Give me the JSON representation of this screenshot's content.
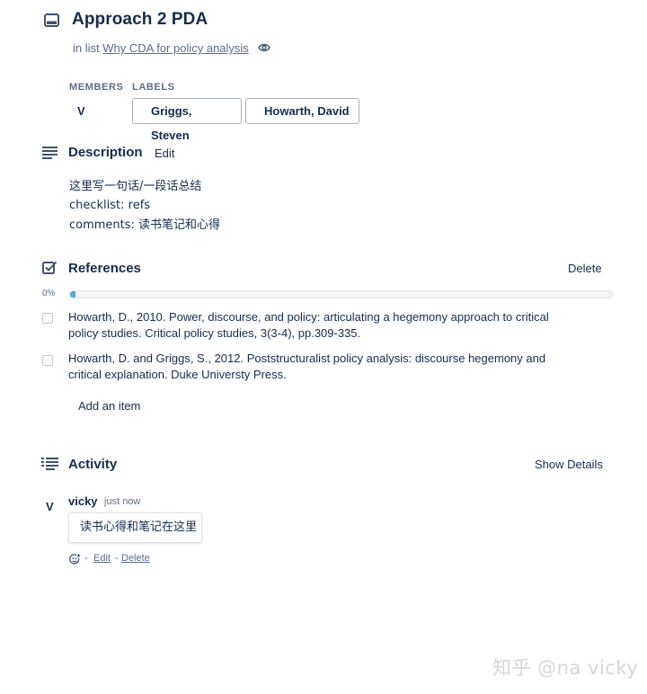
{
  "card": {
    "title": "Approach 2 PDA",
    "in_list_prefix": "in list",
    "list_name": "Why CDA for policy analysis"
  },
  "members": {
    "heading": "MEMBERS",
    "avatar_initial": "V"
  },
  "labels": {
    "heading": "LABELS",
    "items": [
      "Griggs, Steven",
      "Howarth, David"
    ]
  },
  "description": {
    "title": "Description",
    "edit_label": "Edit",
    "lines": [
      "这里写一句话/一段话总结",
      "checklist: refs",
      "comments: 读书笔记和心得"
    ]
  },
  "checklist": {
    "title": "References",
    "delete_label": "Delete",
    "progress_label": "0%",
    "progress": 0.01,
    "items": [
      {
        "text": "Howarth, D., 2010. Power, discourse, and policy: articulating a hegemony approach to critical policy studies. Critical policy studies, 3(3-4), pp.309-335.",
        "checked": false
      },
      {
        "text": "Howarth, D. and Griggs, S., 2012. Poststructuralist policy analysis: discourse hegemony and critical explanation. Duke Universty Press.",
        "checked": false
      }
    ],
    "add_item_label": "Add an item"
  },
  "activity": {
    "title": "Activity",
    "show_details_label": "Show Details",
    "comment": {
      "avatar_initial": "V",
      "author": "vicky",
      "time": "just now",
      "text": "读书心得和笔记在这里",
      "separator": "-",
      "edit_label": "Edit",
      "delete_label": "Delete"
    }
  },
  "watermark": "知乎 @na vicky",
  "icons": {
    "card": "card-icon",
    "watch": "eye-icon",
    "description": "description-lines-icon",
    "checklist": "checkbox-icon",
    "activity": "activity-list-icon",
    "reaction": "add-reaction-icon"
  },
  "colors": {
    "text": "#172b4d",
    "muted": "#5e6c84",
    "border": "#a5adba"
  }
}
